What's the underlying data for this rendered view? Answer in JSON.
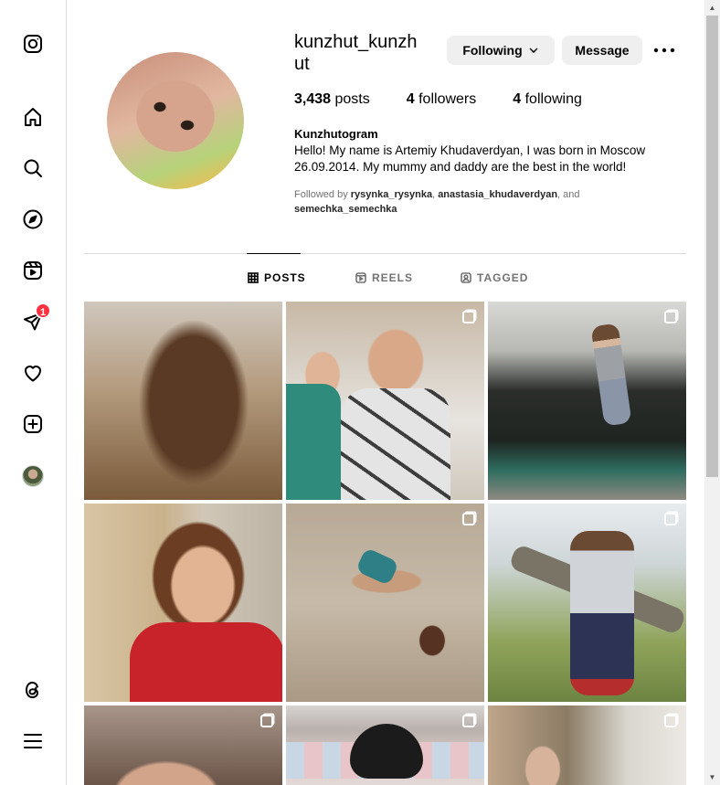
{
  "profile": {
    "username": "kunzhut_kunzhut",
    "display_name": "Kunzhutogram",
    "bio": "Hello! My name is Artemiy Khudaverdyan, I was born in Moscow 26.09.2014. My mummy and daddy are the best in the world!",
    "stats": {
      "posts_count": "3,438",
      "posts_label": "posts",
      "followers_count": "4",
      "followers_label": "followers",
      "following_count": "4",
      "following_label": "following"
    },
    "followed_by": {
      "prefix": "Followed by",
      "user1": "rysynka_rysynka",
      "sep": ",",
      "user2": "anastasia_khudaverdyan",
      "and": ", and",
      "user3": "semechka_semechka"
    }
  },
  "actions": {
    "following_label": "Following",
    "message_label": "Message",
    "more_label": "•••"
  },
  "tabs": [
    {
      "label": "POSTS",
      "active": true
    },
    {
      "label": "REELS",
      "active": false
    },
    {
      "label": "TAGGED",
      "active": false
    }
  ],
  "sidebar": {
    "notifications_badge": "1",
    "icons": [
      "instagram-logo-icon",
      "home-icon",
      "search-icon",
      "explore-compass-icon",
      "reels-icon",
      "messages-icon",
      "heart-icon",
      "create-plus-icon",
      "profile-avatar",
      "threads-icon",
      "menu-icon"
    ]
  },
  "posts": [
    {
      "id": 1,
      "multi": false,
      "subject": "long brown hair, kitchen"
    },
    {
      "id": 2,
      "multi": true,
      "subject": "kids eating, horse print shirt"
    },
    {
      "id": 3,
      "multi": true,
      "subject": "kid jumping on trampoline"
    },
    {
      "id": 4,
      "multi": false,
      "subject": "child in red jacket"
    },
    {
      "id": 5,
      "multi": true,
      "subject": "kid lying in sand"
    },
    {
      "id": 6,
      "multi": true,
      "subject": "kid climbing tree"
    },
    {
      "id": 7,
      "multi": true,
      "subject": "close-up face"
    },
    {
      "id": 8,
      "multi": true,
      "subject": "toy and blanket"
    },
    {
      "id": 9,
      "multi": true,
      "subject": "kid in room"
    }
  ],
  "colors": {
    "badge": "#ff3040",
    "button_bg": "#efefef",
    "muted_text": "#737373",
    "divider": "#dbdbdb"
  }
}
